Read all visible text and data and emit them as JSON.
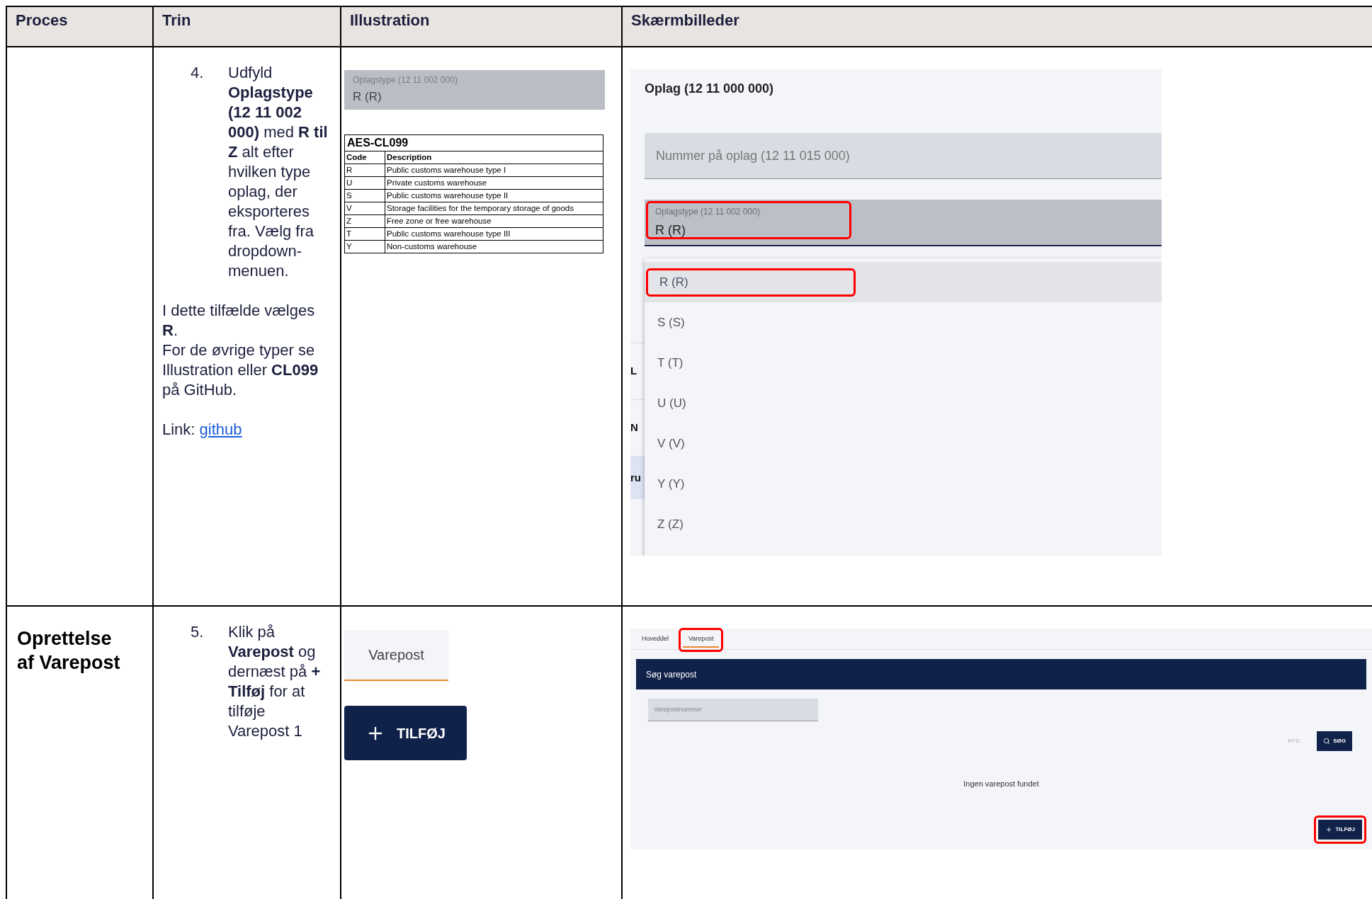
{
  "table": {
    "columns": [
      "Proces",
      "Trin",
      "Illustration",
      "Skærmbilleder"
    ],
    "rows": [
      {
        "step": {
          "number": "4.",
          "text": "Udfyld **Oplagstype (12 11 002 000)** med **R til Z** alt efter hvilken type oplag, der eksporteres fra. Vælg fra dropdown-menuen."
        },
        "notes": [
          "I dette tilfælde vælges **R**.",
          "For de øvrige typer se Illustration eller **CL099** på GitHub."
        ],
        "link": {
          "prefix": "Link:",
          "label": "github"
        },
        "illustration": {
          "field": {
            "label": "Oplagstype (12 11 002 000)",
            "value": "R (R)"
          },
          "code_table": {
            "title": "AES-CL099",
            "columns": [
              "Code",
              "Description"
            ],
            "rows": [
              [
                "R",
                "Public customs warehouse type I"
              ],
              [
                "U",
                "Private customs warehouse"
              ],
              [
                "S",
                "Public customs warehouse type II"
              ],
              [
                "V",
                "Storage facilities for the temporary storage of goods"
              ],
              [
                "Z",
                "Free zone or free warehouse"
              ],
              [
                "T",
                "Public customs warehouse type III"
              ],
              [
                "Y",
                "Non-customs warehouse"
              ]
            ]
          }
        },
        "screenshot": {
          "title": "Oplag (12 11 000 000)",
          "number_field": {
            "placeholder": "Nummer på oplag (12 11 015 000)"
          },
          "type_field": {
            "label": "Oplagstype (12 11 002 000)",
            "value": "R (R)",
            "highlighted": true
          },
          "options": [
            {
              "label": "R (R)",
              "selected": true,
              "highlighted": true
            },
            {
              "label": "S (S)",
              "selected": false,
              "highlighted": false
            },
            {
              "label": "T (T)",
              "selected": false,
              "highlighted": false
            },
            {
              "label": "U (U)",
              "selected": false,
              "highlighted": false
            },
            {
              "label": "V (V)",
              "selected": false,
              "highlighted": false
            },
            {
              "label": "Y (Y)",
              "selected": false,
              "highlighted": false
            },
            {
              "label": "Z (Z)",
              "selected": false,
              "highlighted": false
            }
          ],
          "background_fragments": [
            "L",
            "N",
            "ru"
          ]
        }
      },
      {
        "process": "Oprettelse af Varepost",
        "step": {
          "number": "5.",
          "text": "Klik på **Varepost** og dernæst på **+ Tilføj** for at tilføje Varepost 1"
        },
        "illustration": {
          "tab": {
            "label": "Varepost",
            "selected": true
          },
          "button": {
            "label": "TILFØJ"
          }
        },
        "screenshot": {
          "tabs": [
            {
              "label": "Hoveddel",
              "selected": false,
              "highlighted": false
            },
            {
              "label": "Varepost",
              "selected": true,
              "highlighted": true
            }
          ],
          "header": "Søg varepost",
          "search_field": {
            "placeholder": "Varepostnummer"
          },
          "clear_button": "RYD",
          "search_button": "SØG",
          "empty_message": "Ingen varepost fundet",
          "add_button": {
            "label": "TILFØJ",
            "highlighted": true
          }
        }
      }
    ]
  }
}
